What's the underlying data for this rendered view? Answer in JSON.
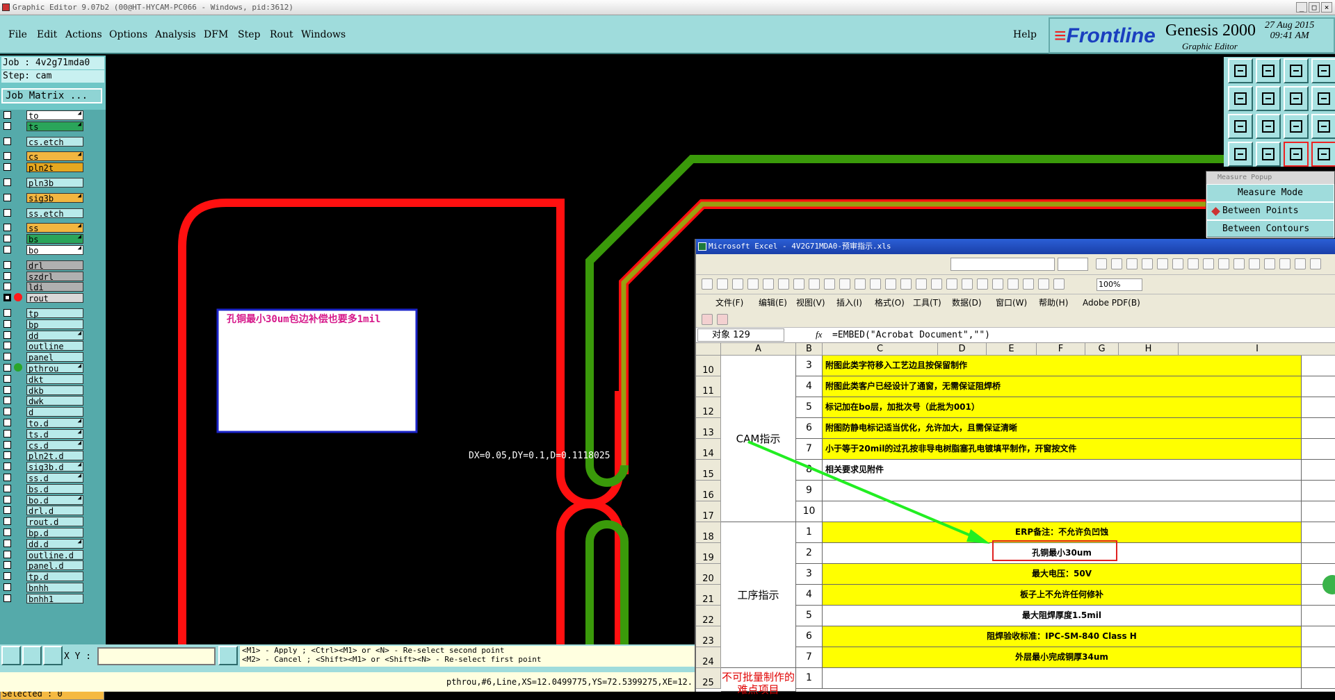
{
  "window_title": "Graphic Editor 9.07b2 (00@HT-HYCAM-PC066 - Windows, pid:3612)",
  "window_buttons": [
    "_",
    "□",
    "×"
  ],
  "menu": [
    "File",
    "Edit",
    "Actions",
    "Options",
    "Analysis",
    "DFM",
    "Step",
    "Rout",
    "Windows"
  ],
  "help_label": "Help",
  "brand": {
    "logo": "Frontline",
    "product": "Genesis 2000",
    "subtitle": "Graphic Editor",
    "date": "27 Aug 2015",
    "time": "09:41 AM"
  },
  "job_label": "Job : 4v2g71mda0",
  "step_label": "Step: cam",
  "job_matrix_label": "Job Matrix ...",
  "layers": [
    {
      "name": "to",
      "color": "#ffffff",
      "checked": false,
      "dot": "",
      "arrow": true
    },
    {
      "name": "ts",
      "color": "#2aa55a",
      "checked": false,
      "dot": "",
      "arrow": true
    },
    {
      "name": "cs.etch",
      "color": "#b8eaea",
      "checked": false,
      "dot": "",
      "arrow": false
    },
    {
      "name": "cs",
      "color": "#f2b640",
      "checked": false,
      "dot": "",
      "arrow": true
    },
    {
      "name": "pln2t",
      "color": "#e6a820",
      "checked": false,
      "dot": "",
      "arrow": false
    },
    {
      "name": "pln3b",
      "color": "#b8eaea",
      "checked": false,
      "dot": "",
      "arrow": false
    },
    {
      "name": "sig3b",
      "color": "#f2b640",
      "checked": false,
      "dot": "",
      "arrow": true
    },
    {
      "name": "ss.etch",
      "color": "#b8eaea",
      "checked": false,
      "dot": "",
      "arrow": false
    },
    {
      "name": "ss",
      "color": "#f2b640",
      "checked": false,
      "dot": "",
      "arrow": true
    },
    {
      "name": "bs",
      "color": "#2aa55a",
      "checked": false,
      "dot": "",
      "arrow": true
    },
    {
      "name": "bo",
      "color": "#ffffff",
      "checked": false,
      "dot": "",
      "arrow": true
    },
    {
      "name": "drl",
      "color": "#b0b0b0",
      "checked": false,
      "dot": "",
      "arrow": false
    },
    {
      "name": "szdrl",
      "color": "#b0b0b0",
      "checked": false,
      "dot": "",
      "arrow": false
    },
    {
      "name": "ldi",
      "color": "#b0b0b0",
      "checked": false,
      "dot": "",
      "arrow": false
    },
    {
      "name": "rout",
      "color": "#d8d8d8",
      "checked": true,
      "dot": "#ff1a1a",
      "arrow": false
    },
    {
      "name": "tp",
      "color": "#b8eaea",
      "checked": false,
      "dot": "",
      "arrow": false
    },
    {
      "name": "bp",
      "color": "#b8eaea",
      "checked": false,
      "dot": "",
      "arrow": false
    },
    {
      "name": "dd",
      "color": "#b8eaea",
      "checked": false,
      "dot": "",
      "arrow": true
    },
    {
      "name": "outline",
      "color": "#b8eaea",
      "checked": false,
      "dot": "",
      "arrow": false
    },
    {
      "name": "panel",
      "color": "#b8eaea",
      "checked": false,
      "dot": "",
      "arrow": false
    },
    {
      "name": "pthrou",
      "color": "#b8eaea",
      "checked": false,
      "dot": "#2aa52a",
      "arrow": true
    },
    {
      "name": "dkt",
      "color": "#b8eaea",
      "checked": false,
      "dot": "",
      "arrow": false
    },
    {
      "name": "dkb",
      "color": "#b8eaea",
      "checked": false,
      "dot": "",
      "arrow": false
    },
    {
      "name": "dwk",
      "color": "#b8eaea",
      "checked": false,
      "dot": "",
      "arrow": false
    },
    {
      "name": "d",
      "color": "#b8eaea",
      "checked": false,
      "dot": "",
      "arrow": false
    },
    {
      "name": "to.d",
      "color": "#b8eaea",
      "checked": false,
      "dot": "",
      "arrow": true
    },
    {
      "name": "ts.d",
      "color": "#b8eaea",
      "checked": false,
      "dot": "",
      "arrow": true
    },
    {
      "name": "cs.d",
      "color": "#b8eaea",
      "checked": false,
      "dot": "",
      "arrow": true
    },
    {
      "name": "pln2t.d",
      "color": "#b8eaea",
      "checked": false,
      "dot": "",
      "arrow": false
    },
    {
      "name": "sig3b.d",
      "color": "#b8eaea",
      "checked": false,
      "dot": "",
      "arrow": true
    },
    {
      "name": "ss.d",
      "color": "#b8eaea",
      "checked": false,
      "dot": "",
      "arrow": true
    },
    {
      "name": "bs.d",
      "color": "#b8eaea",
      "checked": false,
      "dot": "",
      "arrow": false
    },
    {
      "name": "bo.d",
      "color": "#b8eaea",
      "checked": false,
      "dot": "",
      "arrow": true
    },
    {
      "name": "drl.d",
      "color": "#b8eaea",
      "checked": false,
      "dot": "",
      "arrow": false
    },
    {
      "name": "rout.d",
      "color": "#b8eaea",
      "checked": false,
      "dot": "",
      "arrow": false
    },
    {
      "name": "bp.d",
      "color": "#b8eaea",
      "checked": false,
      "dot": "",
      "arrow": false
    },
    {
      "name": "dd.d",
      "color": "#b8eaea",
      "checked": false,
      "dot": "",
      "arrow": true
    },
    {
      "name": "outline.d",
      "color": "#b8eaea",
      "checked": false,
      "dot": "",
      "arrow": false
    },
    {
      "name": "panel.d",
      "color": "#b8eaea",
      "checked": false,
      "dot": "",
      "arrow": false
    },
    {
      "name": "tp.d",
      "color": "#b8eaea",
      "checked": false,
      "dot": "",
      "arrow": false
    },
    {
      "name": "bnhh",
      "color": "#b8eaea",
      "checked": false,
      "dot": "",
      "arrow": false
    },
    {
      "name": "bnhh1",
      "color": "#b8eaea",
      "checked": false,
      "dot": "",
      "arrow": false
    }
  ],
  "selected_label": "Selected : 0",
  "canvas": {
    "note_text": "孔铜最小30um包边补偿也要多1mil",
    "measure_readout": "DX=0.05,DY=0.1,D=0.1118025"
  },
  "measure_popup": {
    "title": "Measure Popup",
    "mode": "Measure Mode",
    "opt1": "Between Points",
    "opt2": "Between Contours"
  },
  "bottom": {
    "xy_label": "X Y :",
    "xy_value": "",
    "hint1": "<M1> - Apply  ; <Ctrl><M1> or <N> - Re-select second point",
    "hint2": "<M2> - Cancel ; <Shift><M1> or <Shift><N> - Re-select first point",
    "status": "pthrou,#6,Line,XS=12.0499775,YS=72.5399275,XE=12."
  },
  "excel": {
    "title": "Microsoft Excel - 4V2G71MDA0-预审指示.xls",
    "zoom": "100%",
    "menu": [
      "文件(F)",
      "编辑(E)",
      "视图(V)",
      "插入(I)",
      "格式(O)",
      "工具(T)",
      "数据(D)",
      "窗口(W)",
      "帮助(H)",
      "Adobe PDF(B)"
    ],
    "name_box": "对象 129",
    "fx": "fx",
    "formula": "=EMBED(\"Acrobat Document\",\"\")",
    "columns": [
      "A",
      "B",
      "C",
      "D",
      "E",
      "F",
      "G",
      "H",
      "I"
    ],
    "groups": [
      {
        "label": "CAM指示",
        "rows": 8
      },
      {
        "label": "工序指示",
        "rows": 7
      },
      {
        "label": "不可批量制作的难点项目",
        "rows": 2
      }
    ],
    "rows": [
      {
        "row": "10",
        "num": "3",
        "text": "附图此类字符移入工艺边且按保留制作",
        "yellow": true,
        "align": "left"
      },
      {
        "row": "11",
        "num": "4",
        "text": "附图此类客户已经设计了通窗，无需保证阻焊桥",
        "yellow": true,
        "align": "left"
      },
      {
        "row": "12",
        "num": "5",
        "text": "标记加在bo层，加批次号（此批为001）",
        "yellow": true,
        "align": "left"
      },
      {
        "row": "13",
        "num": "6",
        "text": "附图防静电标记适当优化，允许加大，且需保证清晰",
        "yellow": true,
        "align": "left"
      },
      {
        "row": "14",
        "num": "7",
        "text": "小于等于20mil的过孔按非导电树脂塞孔电镀填平制作，开窗按文件",
        "yellow": true,
        "align": "left"
      },
      {
        "row": "15",
        "num": "8",
        "text": "相关要求见附件",
        "yellow": false,
        "align": "left"
      },
      {
        "row": "16",
        "num": "9",
        "text": "",
        "yellow": false,
        "align": "left"
      },
      {
        "row": "17",
        "num": "10",
        "text": "",
        "yellow": false,
        "align": "left"
      },
      {
        "row": "18",
        "num": "1",
        "text": "ERP备注：不允许负凹蚀",
        "yellow": true,
        "align": "center"
      },
      {
        "row": "19",
        "num": "2",
        "text": "孔铜最小30um",
        "yellow": false,
        "align": "center"
      },
      {
        "row": "20",
        "num": "3",
        "text": "最大电压：50V",
        "yellow": true,
        "align": "center"
      },
      {
        "row": "21",
        "num": "4",
        "text": "板子上不允许任何修补",
        "yellow": true,
        "align": "center"
      },
      {
        "row": "22",
        "num": "5",
        "text": "最大阻焊厚度1.5mil",
        "yellow": false,
        "align": "center"
      },
      {
        "row": "23",
        "num": "6",
        "text": "阻焊验收标准：IPC-SM-840 Class H",
        "yellow": true,
        "align": "center"
      },
      {
        "row": "24",
        "num": "7",
        "text": "外层最小完成铜厚34um",
        "yellow": true,
        "align": "center"
      },
      {
        "row": "25",
        "num": "1",
        "text": "",
        "yellow": false,
        "align": "center"
      }
    ]
  },
  "colors": {
    "menubar": "#9fdcdc",
    "trace_red": "#ff1010",
    "trace_green": "#3a9a0a",
    "trace_olive": "#9aa010",
    "note_border": "#1b24c8",
    "arrow": "#22ee22",
    "highlight_box": "#e02020"
  }
}
